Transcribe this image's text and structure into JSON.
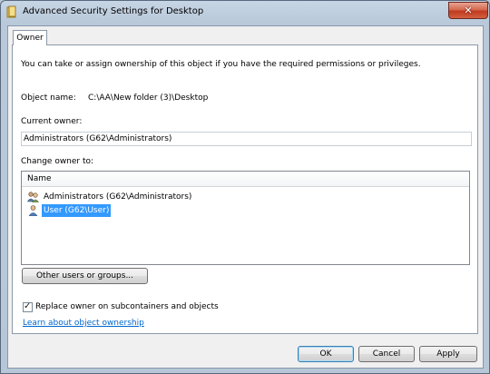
{
  "window": {
    "title": "Advanced Security Settings for Desktop",
    "close_glyph": "✕",
    "icon": "folder-icon"
  },
  "tabs": [
    {
      "label": "Owner",
      "active": true
    }
  ],
  "owner": {
    "intro": "You can take or assign ownership of this object if you have the required permissions or privileges.",
    "object_name_label": "Object name:",
    "object_name_value": "C:\\AA\\New folder (3)\\Desktop",
    "current_owner_label": "Current owner:",
    "current_owner_value": "Administrators (G62\\Administrators)",
    "change_owner_label": "Change owner to:",
    "list": {
      "column_header": "Name",
      "items": [
        {
          "label": "Administrators (G62\\Administrators)",
          "icon": "users-group-icon",
          "selected": false
        },
        {
          "label": "User (G62\\User)",
          "icon": "user-icon",
          "selected": true
        }
      ]
    },
    "other_users_button": "Other users or groups...",
    "replace_checkbox_label": "Replace owner on subcontainers and objects",
    "replace_checked": true,
    "check_glyph": "✓",
    "learn_link": "Learn about object ownership"
  },
  "footer": {
    "ok": "OK",
    "cancel": "Cancel",
    "apply": "Apply"
  }
}
